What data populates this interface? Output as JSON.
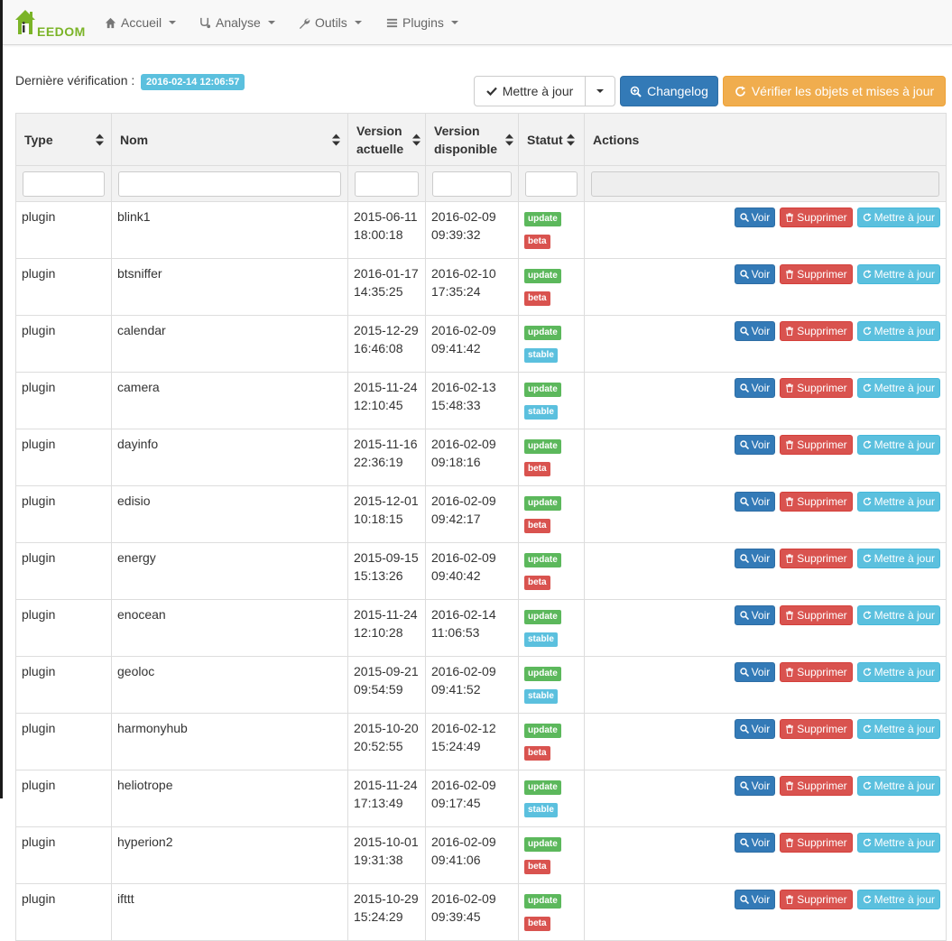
{
  "navbar": {
    "brand": "EEDOM",
    "items": [
      {
        "label": "Accueil",
        "icon": "home-icon"
      },
      {
        "label": "Analyse",
        "icon": "stethoscope-icon"
      },
      {
        "label": "Outils",
        "icon": "wrench-icon"
      },
      {
        "label": "Plugins",
        "icon": "list-icon"
      }
    ]
  },
  "toolbar": {
    "last_check_label": "Dernière vérification :",
    "last_check_date": "2016-02-14 12:06:57",
    "update_label": "Mettre à jour",
    "changelog_label": "Changelog",
    "verify_label": "Vérifier les objets et mises à jour"
  },
  "colors": {
    "primary": "#337ab7",
    "danger": "#d9534f",
    "info": "#5bc0de",
    "success": "#5cb85c",
    "warning": "#f0ad4e"
  },
  "table": {
    "headers": {
      "type": "Type",
      "nom": "Nom",
      "version_actuelle_1": "Version",
      "version_actuelle_2": "actuelle",
      "version_dispo_1": "Version",
      "version_dispo_2": "disponible",
      "statut": "Statut",
      "actions": "Actions"
    },
    "action_labels": {
      "voir": "Voir",
      "supprimer": "Supprimer",
      "mettre": "Mettre à jour"
    },
    "rows": [
      {
        "type": "plugin",
        "name": "blink1",
        "cur_d": "2015-06-11",
        "cur_t": "18:00:18",
        "av_d": "2016-02-09",
        "av_t": "09:39:32",
        "status": "update",
        "channel": "beta"
      },
      {
        "type": "plugin",
        "name": "btsniffer",
        "cur_d": "2016-01-17",
        "cur_t": "14:35:25",
        "av_d": "2016-02-10",
        "av_t": "17:35:24",
        "status": "update",
        "channel": "beta"
      },
      {
        "type": "plugin",
        "name": "calendar",
        "cur_d": "2015-12-29",
        "cur_t": "16:46:08",
        "av_d": "2016-02-09",
        "av_t": "09:41:42",
        "status": "update",
        "channel": "stable"
      },
      {
        "type": "plugin",
        "name": "camera",
        "cur_d": "2015-11-24",
        "cur_t": "12:10:45",
        "av_d": "2016-02-13",
        "av_t": "15:48:33",
        "status": "update",
        "channel": "stable"
      },
      {
        "type": "plugin",
        "name": "dayinfo",
        "cur_d": "2015-11-16",
        "cur_t": "22:36:19",
        "av_d": "2016-02-09",
        "av_t": "09:18:16",
        "status": "update",
        "channel": "beta"
      },
      {
        "type": "plugin",
        "name": "edisio",
        "cur_d": "2015-12-01",
        "cur_t": "10:18:15",
        "av_d": "2016-02-09",
        "av_t": "09:42:17",
        "status": "update",
        "channel": "beta"
      },
      {
        "type": "plugin",
        "name": "energy",
        "cur_d": "2015-09-15",
        "cur_t": "15:13:26",
        "av_d": "2016-02-09",
        "av_t": "09:40:42",
        "status": "update",
        "channel": "beta"
      },
      {
        "type": "plugin",
        "name": "enocean",
        "cur_d": "2015-11-24",
        "cur_t": "12:10:28",
        "av_d": "2016-02-14",
        "av_t": "11:06:53",
        "status": "update",
        "channel": "stable"
      },
      {
        "type": "plugin",
        "name": "geoloc",
        "cur_d": "2015-09-21",
        "cur_t": "09:54:59",
        "av_d": "2016-02-09",
        "av_t": "09:41:52",
        "status": "update",
        "channel": "stable"
      },
      {
        "type": "plugin",
        "name": "harmonyhub",
        "cur_d": "2015-10-20",
        "cur_t": "20:52:55",
        "av_d": "2016-02-12",
        "av_t": "15:24:49",
        "status": "update",
        "channel": "beta"
      },
      {
        "type": "plugin",
        "name": "heliotrope",
        "cur_d": "2015-11-24",
        "cur_t": "17:13:49",
        "av_d": "2016-02-09",
        "av_t": "09:17:45",
        "status": "update",
        "channel": "stable"
      },
      {
        "type": "plugin",
        "name": "hyperion2",
        "cur_d": "2015-10-01",
        "cur_t": "19:31:38",
        "av_d": "2016-02-09",
        "av_t": "09:41:06",
        "status": "update",
        "channel": "beta"
      },
      {
        "type": "plugin",
        "name": "ifttt",
        "cur_d": "2015-10-29",
        "cur_t": "15:24:29",
        "av_d": "2016-02-09",
        "av_t": "09:39:45",
        "status": "update",
        "channel": "beta"
      }
    ]
  }
}
